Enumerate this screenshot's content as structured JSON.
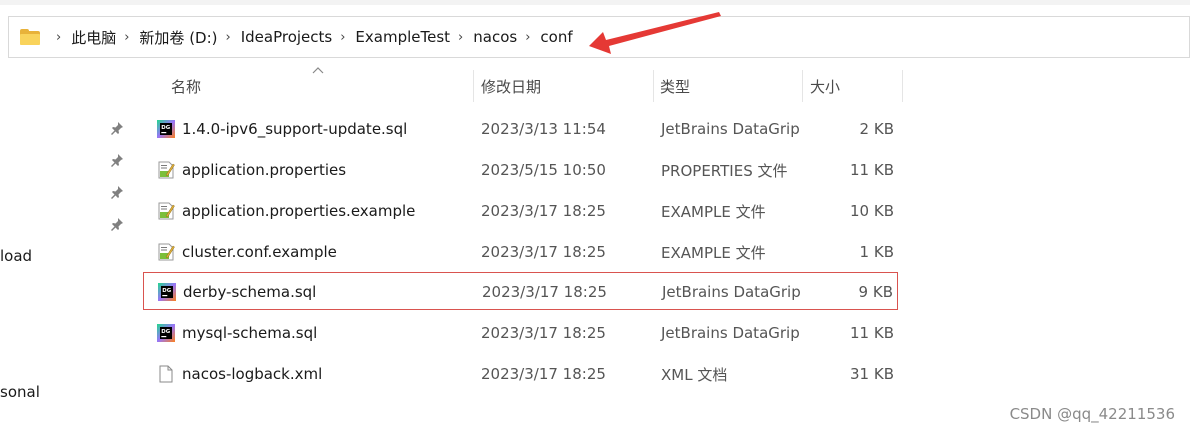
{
  "breadcrumb": {
    "items": [
      "此电脑",
      "新加卷 (D:)",
      "IdeaProjects",
      "ExampleTest",
      "nacos",
      "conf"
    ],
    "separator": "›"
  },
  "nav": {
    "items": [
      "load",
      "sonal"
    ]
  },
  "columns": {
    "name": "名称",
    "date": "修改日期",
    "type": "类型",
    "size": "大小"
  },
  "files": [
    {
      "name": "1.4.0-ipv6_support-update.sql",
      "date": "2023/3/13 11:54",
      "type": "JetBrains DataGrip",
      "size": "2 KB",
      "icon": "datagrip-icon"
    },
    {
      "name": "application.properties",
      "date": "2023/5/15 10:50",
      "type": "PROPERTIES 文件",
      "size": "11 KB",
      "icon": "properties-file-icon"
    },
    {
      "name": "application.properties.example",
      "date": "2023/3/17 18:25",
      "type": "EXAMPLE 文件",
      "size": "10 KB",
      "icon": "properties-file-icon"
    },
    {
      "name": "cluster.conf.example",
      "date": "2023/3/17 18:25",
      "type": "EXAMPLE 文件",
      "size": "1 KB",
      "icon": "properties-file-icon"
    },
    {
      "name": "derby-schema.sql",
      "date": "2023/3/17 18:25",
      "type": "JetBrains DataGrip",
      "size": "9 KB",
      "icon": "datagrip-icon",
      "highlighted": true
    },
    {
      "name": "mysql-schema.sql",
      "date": "2023/3/17 18:25",
      "type": "JetBrains DataGrip",
      "size": "11 KB",
      "icon": "datagrip-icon"
    },
    {
      "name": "nacos-logback.xml",
      "date": "2023/3/17 18:25",
      "type": "XML 文档",
      "size": "31 KB",
      "icon": "blank-file-icon"
    }
  ],
  "watermark": "CSDN @qq_42211536",
  "colors": {
    "highlight_border": "#d9534f",
    "annotation_arrow": "#e53935",
    "folder": "#f9d35c"
  }
}
